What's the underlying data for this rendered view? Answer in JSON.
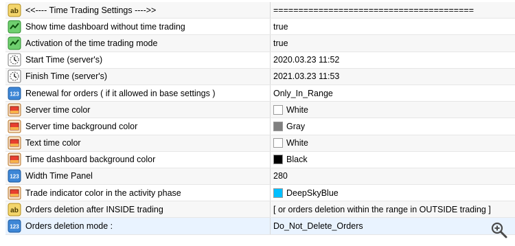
{
  "rows": [
    {
      "icon": "ab-text-icon",
      "name": "<<---- Time Trading Settings ---->>",
      "value": "========================================",
      "color": null
    },
    {
      "icon": "bool-icon",
      "name": "Show time dashboard without time trading",
      "value": "true",
      "color": null
    },
    {
      "icon": "bool-icon",
      "name": "Activation of the time trading mode",
      "value": "true",
      "color": null
    },
    {
      "icon": "datetime-icon",
      "name": "Start Time (server's)",
      "value": "2020.03.23 11:52",
      "color": null
    },
    {
      "icon": "datetime-icon",
      "name": "Finish Time (server's)",
      "value": "2021.03.23 11:53",
      "color": null
    },
    {
      "icon": "enum-123-icon",
      "name": "Renewal for orders  ( if it allowed in base settings )",
      "value": "Only_In_Range",
      "color": null
    },
    {
      "icon": "color-icon",
      "name": "Server time color",
      "value": "White",
      "color": "#ffffff"
    },
    {
      "icon": "color-icon",
      "name": "Server time background color",
      "value": "Gray",
      "color": "#808080"
    },
    {
      "icon": "color-icon",
      "name": "Text time color",
      "value": "White",
      "color": "#ffffff"
    },
    {
      "icon": "color-icon",
      "name": "Time dashboard background color",
      "value": "Black",
      "color": "#000000"
    },
    {
      "icon": "enum-123-icon",
      "name": "Width Time Panel",
      "value": "280",
      "color": null
    },
    {
      "icon": "color-icon",
      "name": "Trade indicator color in the activity phase",
      "value": "DeepSkyBlue",
      "color": "#00bfff"
    },
    {
      "icon": "ab-text-icon",
      "name": "Orders deletion after INSIDE trading",
      "value": "[  or orders deletion within the range in OUTSIDE trading  ]",
      "color": null
    },
    {
      "icon": "enum-123-icon",
      "name": "Orders deletion mode :",
      "value": "Do_Not_Delete_Orders",
      "color": null
    }
  ],
  "zoom": {
    "icon": "zoom-in-icon"
  }
}
